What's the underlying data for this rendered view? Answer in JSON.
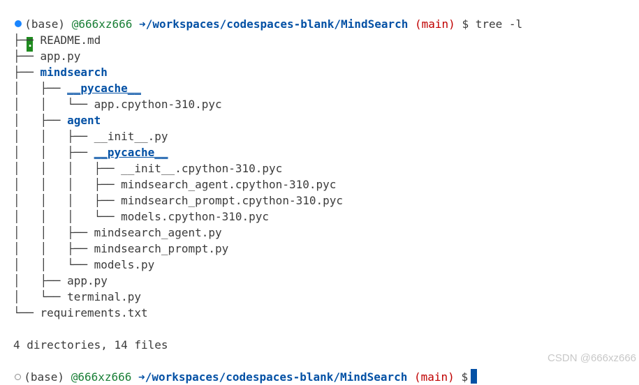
{
  "prompt": {
    "env": "(base)",
    "user": "@666xz666",
    "arrow": "➜",
    "path": "/workspaces/codespaces-blank/MindSearch",
    "branch": "(main)",
    "symbol": "$",
    "command": "tree -l"
  },
  "tree": {
    "root": ".",
    "rows": [
      {
        "prefix": "├── ",
        "name": "README.md",
        "kind": "file"
      },
      {
        "prefix": "├── ",
        "name": "app.py",
        "kind": "file"
      },
      {
        "prefix": "├── ",
        "name": "mindsearch",
        "kind": "dir"
      },
      {
        "prefix": "│   ├── ",
        "name": "__pycache__",
        "kind": "dir-under"
      },
      {
        "prefix": "│   │   └── ",
        "name": "app.cpython-310.pyc",
        "kind": "file"
      },
      {
        "prefix": "│   ├── ",
        "name": "agent",
        "kind": "dir"
      },
      {
        "prefix": "│   │   ├── ",
        "name": "__init__.py",
        "kind": "file"
      },
      {
        "prefix": "│   │   ├── ",
        "name": "__pycache__",
        "kind": "dir-under"
      },
      {
        "prefix": "│   │   │   ├── ",
        "name": "__init__.cpython-310.pyc",
        "kind": "file"
      },
      {
        "prefix": "│   │   │   ├── ",
        "name": "mindsearch_agent.cpython-310.pyc",
        "kind": "file"
      },
      {
        "prefix": "│   │   │   ├── ",
        "name": "mindsearch_prompt.cpython-310.pyc",
        "kind": "file"
      },
      {
        "prefix": "│   │   │   └── ",
        "name": "models.cpython-310.pyc",
        "kind": "file"
      },
      {
        "prefix": "│   │   ├── ",
        "name": "mindsearch_agent.py",
        "kind": "file"
      },
      {
        "prefix": "│   │   ├── ",
        "name": "mindsearch_prompt.py",
        "kind": "file"
      },
      {
        "prefix": "│   │   └── ",
        "name": "models.py",
        "kind": "file"
      },
      {
        "prefix": "│   ├── ",
        "name": "app.py",
        "kind": "file"
      },
      {
        "prefix": "│   └── ",
        "name": "terminal.py",
        "kind": "file"
      },
      {
        "prefix": "└── ",
        "name": "requirements.txt",
        "kind": "file"
      }
    ]
  },
  "summary": "4 directories, 14 files",
  "watermark": "CSDN @666xz666",
  "colors": {
    "path": "#0451a5",
    "branch": "#c00000",
    "user": "#1a7f37",
    "cursor": "#0451a5",
    "root_highlight": "#1f8a1f"
  }
}
